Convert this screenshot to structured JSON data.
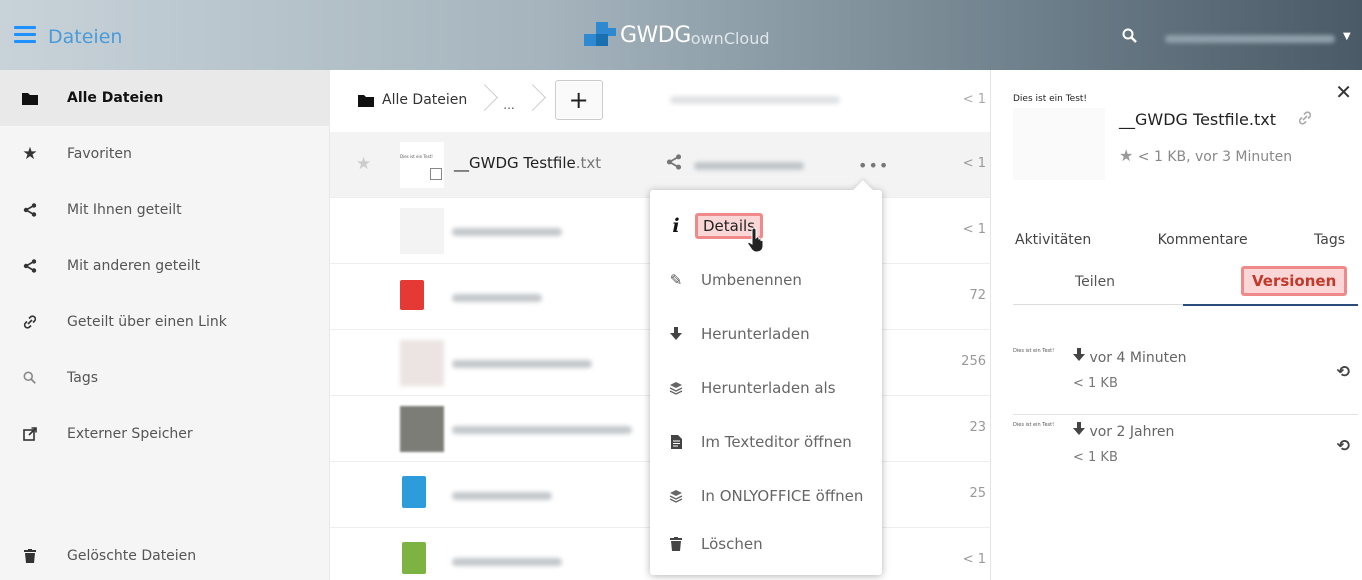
{
  "header": {
    "app_name": "Dateien",
    "logo_brand": "GWDG",
    "logo_sub": "ownCloud",
    "accent": "#1e90ff"
  },
  "sidebar": {
    "items": [
      {
        "label": "Alle Dateien",
        "icon": "folder-icon"
      },
      {
        "label": "Favoriten",
        "icon": "star-icon"
      },
      {
        "label": "Mit Ihnen geteilt",
        "icon": "share-icon"
      },
      {
        "label": "Mit anderen geteilt",
        "icon": "share-icon"
      },
      {
        "label": "Geteilt über einen Link",
        "icon": "link-icon"
      },
      {
        "label": "Tags",
        "icon": "search-icon"
      },
      {
        "label": "Externer Speicher",
        "icon": "external-icon"
      }
    ],
    "deleted_label": "Gelöschte Dateien"
  },
  "breadcrumb": {
    "root": "Alle Dateien",
    "ellipsis": "...",
    "add": "+",
    "header_user_blur": "tobias.herbst@...",
    "header_size": "< 1"
  },
  "files": {
    "selected": {
      "thumb_text": "Dies ist ein Test!",
      "name": "__GWDG Testfile",
      "ext": ".txt",
      "size": "< 1",
      "actions": "•••"
    },
    "row_sizes": [
      "< 1",
      "72",
      "256",
      "23",
      "25",
      "< 1"
    ]
  },
  "menu": {
    "items": [
      {
        "label": "Details",
        "icon": "info-icon"
      },
      {
        "label": "Umbenennen",
        "icon": "pencil-icon"
      },
      {
        "label": "Herunterladen",
        "icon": "download-icon"
      },
      {
        "label": "Herunterladen als",
        "icon": "layers-icon"
      },
      {
        "label": "Im Texteditor öffnen",
        "icon": "document-icon"
      },
      {
        "label": "In ONLYOFFICE öffnen",
        "icon": "layers-icon"
      },
      {
        "label": "Löschen",
        "icon": "trash-icon"
      }
    ]
  },
  "details": {
    "preview_text": "Dies ist ein Test!",
    "title": "__GWDG Testfile.txt",
    "meta": "< 1 KB, vor 3 Minuten",
    "tabs_row1": [
      "Aktivitäten",
      "Kommentare",
      "Tags"
    ],
    "tab_teilen": "Teilen",
    "tab_versionen": "Versionen",
    "versions": [
      {
        "when": "vor 4 Minuten",
        "size": "< 1 KB",
        "thumb_text": "Dies ist ein Test!"
      },
      {
        "when": "vor 2 Jahren",
        "size": "< 1 KB",
        "thumb_text": "Dies ist ein Test!"
      }
    ]
  }
}
